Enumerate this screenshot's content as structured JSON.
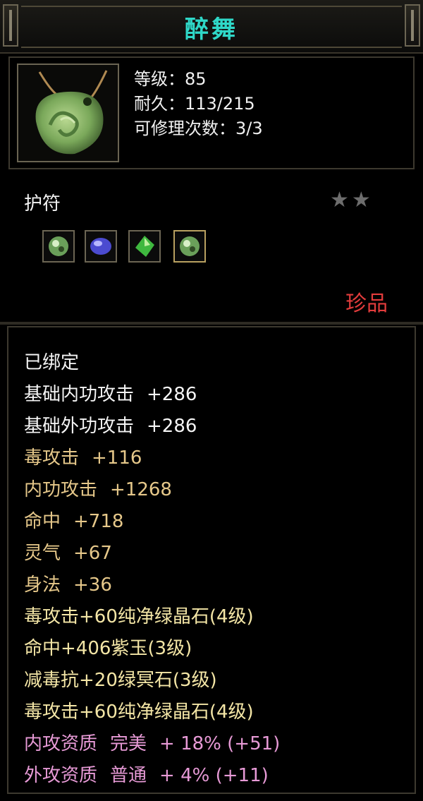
{
  "title": "醉舞",
  "stats": {
    "level": "等级：85",
    "durability": "耐久：113/215",
    "repairs": "可修理次数：3/3"
  },
  "category": "护符",
  "stars": "★★",
  "rarity": "珍品",
  "gems": [
    {
      "icon": "jade-gem-icon",
      "color": "#7fbf6a"
    },
    {
      "icon": "purple-gem-icon",
      "color": "#6a6ae0"
    },
    {
      "icon": "green-crystal-icon",
      "color": "#3fbf3f"
    },
    {
      "icon": "jade-gem-icon",
      "color": "#7fbf6a"
    }
  ],
  "bound": "已绑定",
  "attributes": [
    {
      "name": "基础内功攻击",
      "value": "+286",
      "color": "white"
    },
    {
      "name": "基础外功攻击",
      "value": "+286",
      "color": "white"
    },
    {
      "name": "毒攻击",
      "value": "+116",
      "color": "gold"
    },
    {
      "name": "内功攻击",
      "value": "+1268",
      "color": "gold"
    },
    {
      "name": "命中",
      "value": "+718",
      "color": "gold"
    },
    {
      "name": "灵气",
      "value": "+67",
      "color": "gold"
    },
    {
      "name": "身法",
      "value": "+36",
      "color": "gold"
    }
  ],
  "gem_effects": [
    "毒攻击+60纯净绿晶石(4级)",
    "命中+406紫玉(3级)",
    "减毒抗+20绿冥石(3级)",
    "毒攻击+60纯净绿晶石(4级)"
  ],
  "qualities": [
    {
      "name": "内攻资质",
      "grade": "完美",
      "value": "+ 18% (+51)"
    },
    {
      "name": "外攻资质",
      "grade": "普通",
      "value": "+ 4% (+11)"
    }
  ]
}
